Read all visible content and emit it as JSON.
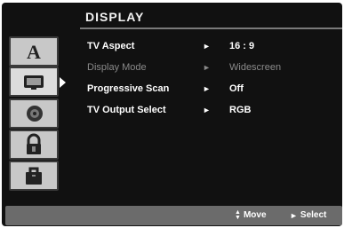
{
  "header": {
    "title": "DISPLAY"
  },
  "sidebar": {
    "tabs": [
      {
        "icon": "language-icon",
        "selected": false
      },
      {
        "icon": "display-icon",
        "selected": true
      },
      {
        "icon": "audio-icon",
        "selected": false
      },
      {
        "icon": "lock-icon",
        "selected": false
      },
      {
        "icon": "others-icon",
        "selected": false
      }
    ]
  },
  "menu": {
    "items": [
      {
        "label": "TV Aspect",
        "pointer": "►",
        "value": "16 : 9",
        "enabled": true
      },
      {
        "label": "Display Mode",
        "pointer": "►",
        "value": "Widescreen",
        "enabled": false
      },
      {
        "label": "Progressive Scan",
        "pointer": "►",
        "value": "Off",
        "enabled": true
      },
      {
        "label": "TV Output Select",
        "pointer": "►",
        "value": "RGB",
        "enabled": true
      }
    ]
  },
  "footer": {
    "move_glyph": "▲▼",
    "move_label": "Move",
    "select_glyph": "►",
    "select_label": "Select"
  },
  "colors": {
    "background": "#111111",
    "tab": "#c8c8c8",
    "footer": "#6b6b6b",
    "text": "#ffffff",
    "disabled_text": "#8a8a8a"
  }
}
